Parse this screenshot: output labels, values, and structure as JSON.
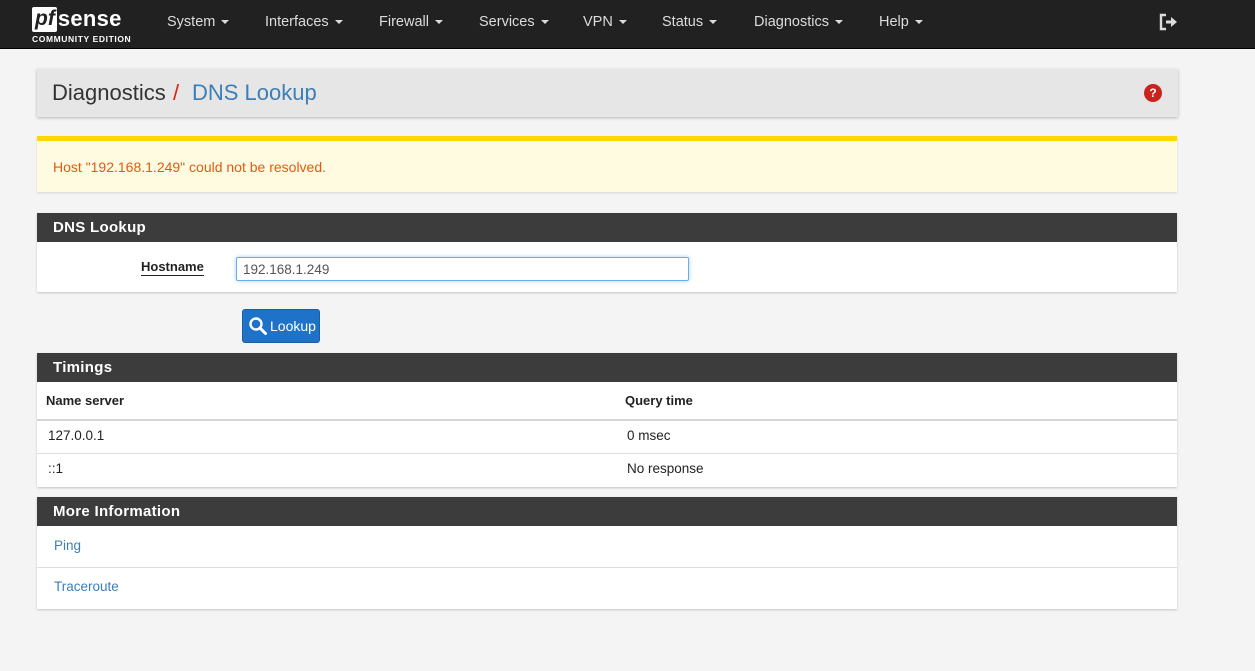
{
  "brand": {
    "pf": "pf",
    "sense": "sense",
    "edition": "COMMUNITY EDITION"
  },
  "nav": {
    "items": [
      "System",
      "Interfaces",
      "Firewall",
      "Services",
      "VPN",
      "Status",
      "Diagnostics",
      "Help"
    ],
    "logout_icon": "sign-out-icon"
  },
  "breadcrumb": {
    "parent": "Diagnostics",
    "separator": "/",
    "current": "DNS Lookup",
    "help_icon": "question-circle-icon"
  },
  "alert": {
    "message": "Host \"192.168.1.249\" could not be resolved."
  },
  "dns_lookup": {
    "title": "DNS Lookup",
    "hostname_label": "Hostname",
    "hostname_value": "192.168.1.249",
    "button_label": "Lookup",
    "button_icon": "search-icon"
  },
  "timings": {
    "title": "Timings",
    "columns": [
      "Name server",
      "Query time"
    ],
    "rows": [
      [
        "127.0.0.1",
        "0 msec"
      ],
      [
        "::1",
        "No response"
      ]
    ]
  },
  "more_info": {
    "title": "More Information",
    "links": [
      "Ping",
      "Traceroute"
    ]
  },
  "colors": {
    "navbar": "#212121",
    "accent_red": "#d9230f",
    "link_blue": "#3c7eb8",
    "alert_bg": "#fffbe0",
    "alert_border": "#ffd600",
    "alert_text": "#e05a12",
    "panel_head": "#3c3c3c",
    "button_blue": "#1e73c8"
  }
}
